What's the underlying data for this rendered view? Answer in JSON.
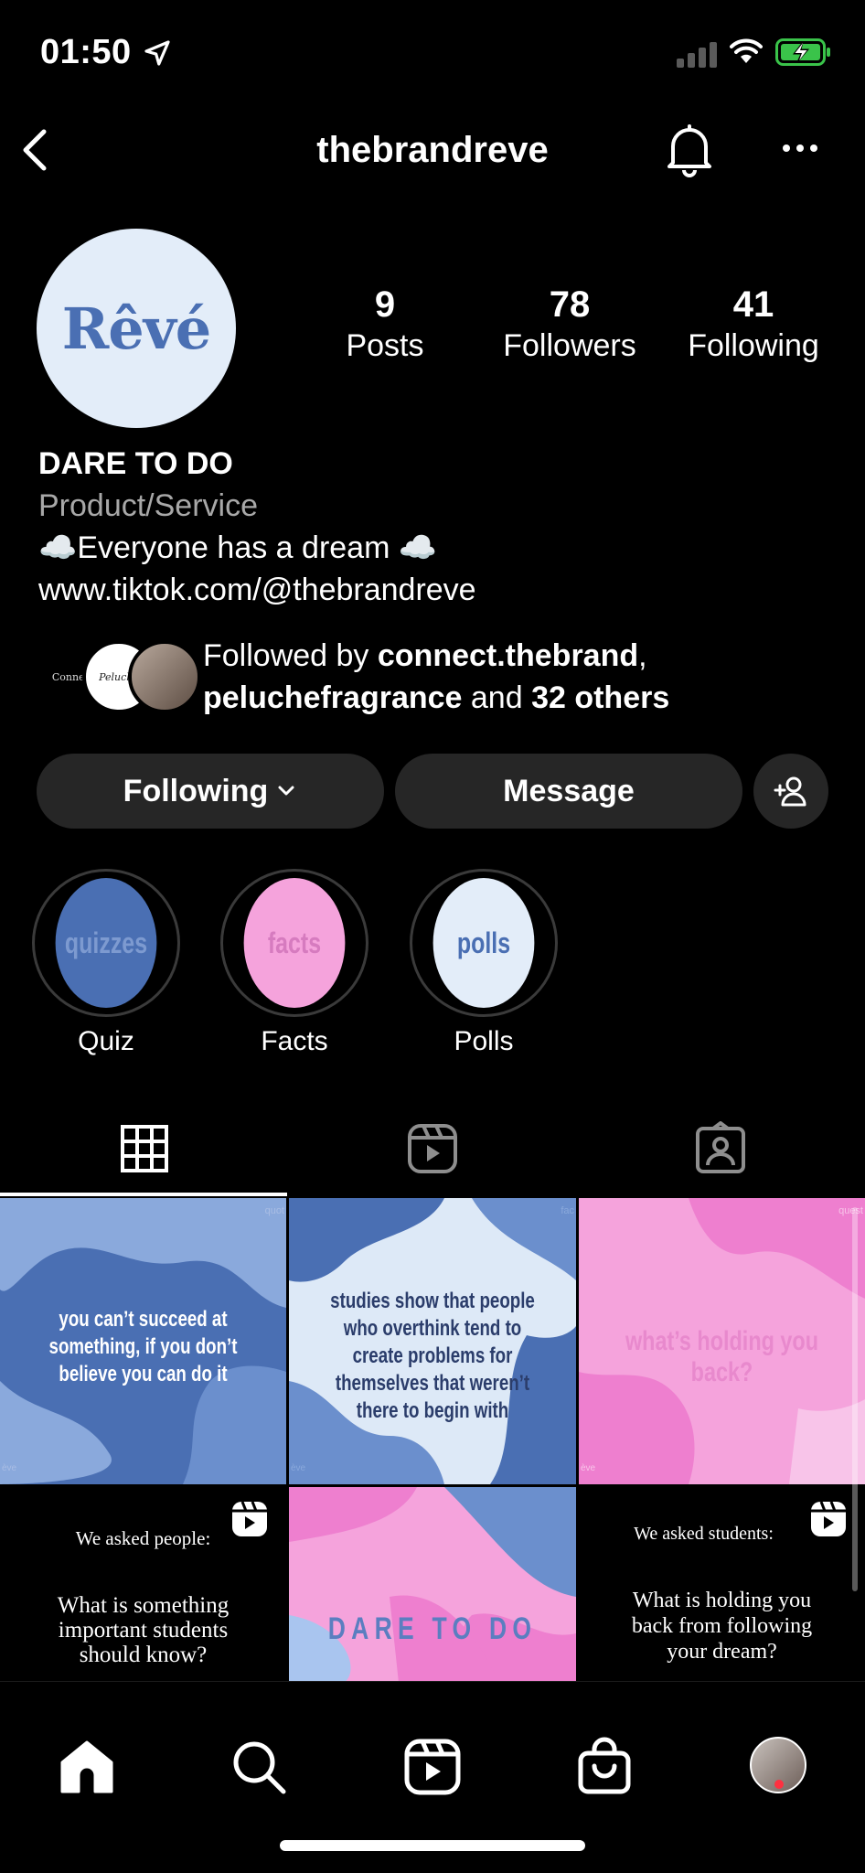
{
  "status": {
    "time": "01:50"
  },
  "nav": {
    "title": "thebrandreve"
  },
  "profile": {
    "avatar_text": "Rêvé",
    "posts_count": "9",
    "posts_label": "Posts",
    "followers_count": "78",
    "followers_label": "Followers",
    "following_count": "41",
    "following_label": "Following",
    "name": "DARE TO DO",
    "category": "Product/Service",
    "bio": "☁️Everyone has a dream ☁️",
    "link": "www.tiktok.com/@thebrandreve",
    "followed_prefix": "Followed by ",
    "followed_user1": "connect.thebrand",
    "followed_sep": ",",
    "followed_user2": "peluchefragrance",
    "followed_and": " and ",
    "followed_others": "32 others",
    "followed_av1": "Connect",
    "followed_av2": "Peluche"
  },
  "actions": {
    "following_label": "Following",
    "message_label": "Message"
  },
  "highlights": [
    {
      "inner": "quizzes",
      "label": "Quiz",
      "bg": "#4a6fb3",
      "fg": "#7d9ad0"
    },
    {
      "inner": "facts",
      "label": "Facts",
      "bg": "#f5a3dc",
      "fg": "#d67bbf"
    },
    {
      "inner": "polls",
      "label": "Polls",
      "bg": "#e3edf9",
      "fg": "#4a6fb3"
    }
  ],
  "posts": [
    {
      "text": "you can’t succeed at something, if you don’t believe you can do it",
      "corner": "quot",
      "foot": "ève"
    },
    {
      "text": "studies show that people who overthink tend to create problems for themselves that weren’t there to begin with",
      "corner": "fac",
      "foot": "ève"
    },
    {
      "text": "what’s holding you back?",
      "corner": "quest",
      "foot": "ève"
    },
    {
      "top": "We asked people:",
      "text": "What is something important students should know?"
    },
    {
      "text": "DARE TO DO"
    },
    {
      "top": "We asked students:",
      "text": "What is holding you back from following your dream?"
    }
  ],
  "colors": {
    "blue": "#4a6fb3",
    "light_blue": "#e3edf9",
    "pink": "#f5a3dc",
    "button_bg": "#262626",
    "notification": "#ff3040"
  }
}
